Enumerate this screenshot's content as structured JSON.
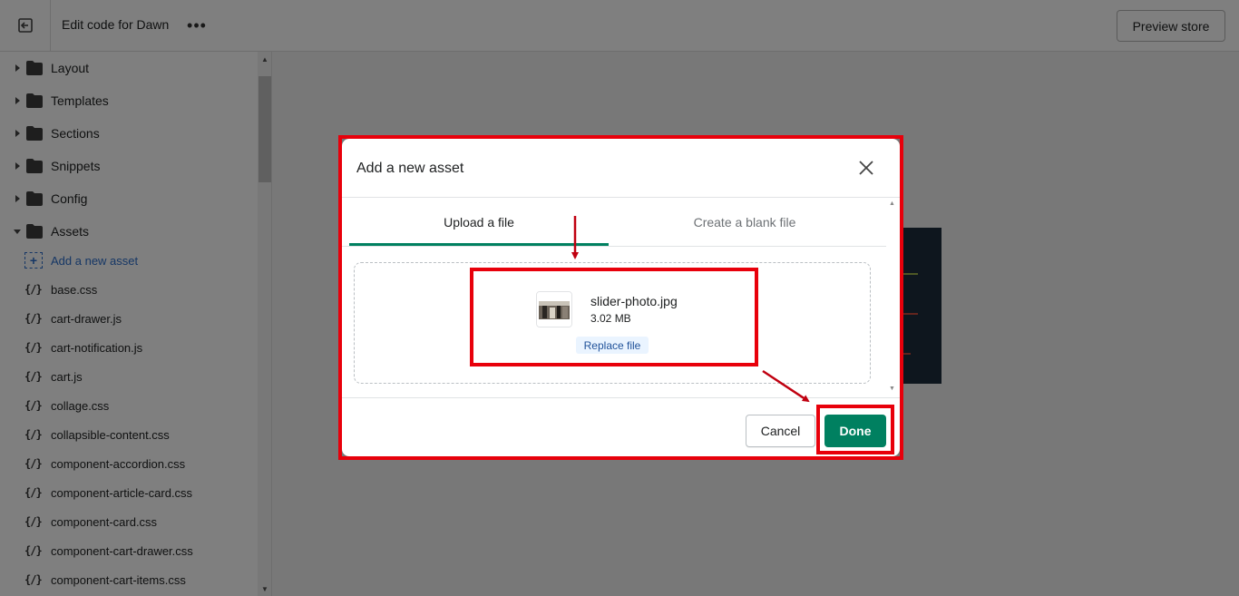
{
  "topbar": {
    "title": "Edit code for Dawn",
    "more_label": "•••",
    "preview_label": "Preview store"
  },
  "sidebar": {
    "folders": [
      {
        "label": "Layout",
        "expanded": false
      },
      {
        "label": "Templates",
        "expanded": false
      },
      {
        "label": "Sections",
        "expanded": false
      },
      {
        "label": "Snippets",
        "expanded": false
      },
      {
        "label": "Config",
        "expanded": false
      },
      {
        "label": "Assets",
        "expanded": true
      }
    ],
    "add_asset_label": "Add a new asset",
    "file_icon_text": "{/}",
    "files": [
      "base.css",
      "cart-drawer.js",
      "cart-notification.js",
      "cart.js",
      "collage.css",
      "collapsible-content.css",
      "component-accordion.css",
      "component-article-card.css",
      "component-card.css",
      "component-cart-drawer.css",
      "component-cart-items.css"
    ]
  },
  "modal": {
    "title": "Add a new asset",
    "tabs": [
      {
        "label": "Upload a file",
        "active": true
      },
      {
        "label": "Create a blank file",
        "active": false
      }
    ],
    "file": {
      "name": "slider-photo.jpg",
      "size": "3.02 MB",
      "replace_label": "Replace file"
    },
    "cancel_label": "Cancel",
    "done_label": "Done"
  },
  "colors": {
    "primary_green": "#008060",
    "link_blue": "#2c6ecb",
    "annotation_red": "#e8000b"
  }
}
